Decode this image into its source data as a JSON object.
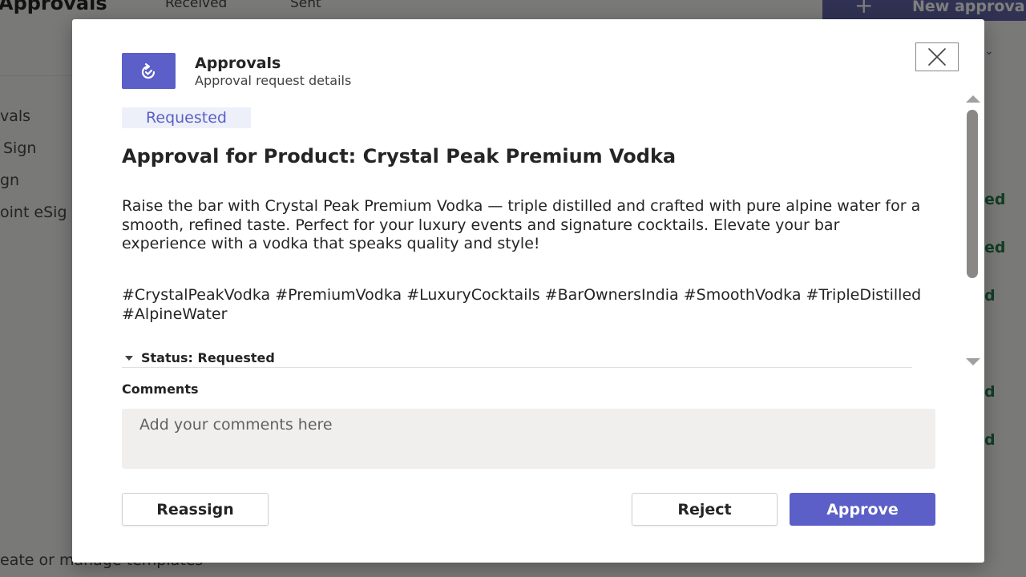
{
  "background": {
    "title": "Approvals",
    "tabs": [
      "Received",
      "Sent"
    ],
    "new_button": "New approval",
    "sidebar": [
      "vals",
      "Sign",
      "gn",
      "oint eSig"
    ],
    "status_fragments": [
      "ed",
      "ed",
      "d",
      "d",
      "d"
    ],
    "templates_link": "eate or manage templates"
  },
  "dialog": {
    "app_name": "Approvals",
    "app_subtitle": "Approval request details",
    "status_badge": "Requested",
    "title": "Approval for Product: Crystal Peak Premium Vodka",
    "description": "Raise the bar with Crystal Peak Premium Vodka — triple distilled and crafted with pure alpine water for a smooth, refined taste. Perfect for your luxury events and signature cocktails. Elevate your bar experience with a vodka that speaks quality and style!",
    "hashtags": "#CrystalPeakVodka #PremiumVodka #LuxuryCocktails #BarOwnersIndia #SmoothVodka #TripleDistilled #AlpineWater",
    "status_section": "Status: Requested",
    "comments_label": "Comments",
    "comments_placeholder": "Add your comments here",
    "comments_value": "",
    "buttons": {
      "reassign": "Reassign",
      "reject": "Reject",
      "approve": "Approve"
    }
  },
  "colors": {
    "accent": "#5b5fc7",
    "badge_bg": "#eef0f9",
    "status_green": "#237b4b"
  },
  "icons": {
    "app": "approvals-icon",
    "close": "close-icon",
    "expand": "caret-down-icon"
  }
}
